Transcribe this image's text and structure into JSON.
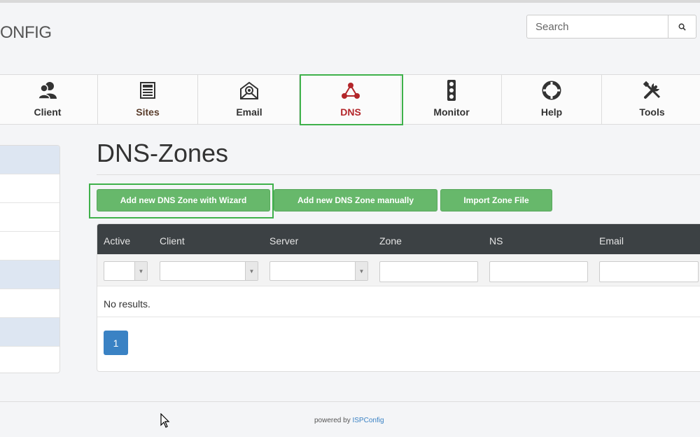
{
  "header": {
    "logo_text": "ONFIG",
    "search_placeholder": "Search",
    "search_icon": "magnifier-icon"
  },
  "nav": {
    "items": [
      {
        "label": "Client",
        "icon": "client-icon"
      },
      {
        "label": "Sites",
        "icon": "sites-icon"
      },
      {
        "label": "Email",
        "icon": "email-icon"
      },
      {
        "label": "DNS",
        "icon": "dns-icon"
      },
      {
        "label": "Monitor",
        "icon": "monitor-icon"
      },
      {
        "label": "Help",
        "icon": "help-icon"
      },
      {
        "label": "Tools",
        "icon": "tools-icon"
      }
    ],
    "active": "DNS",
    "active_color": "#b3262a",
    "highlight_color": "#3fb14b"
  },
  "main": {
    "title": "DNS-Zones",
    "buttons": {
      "wizard": "Add new DNS Zone with Wizard",
      "manual": "Add new DNS Zone manually",
      "import": "Import Zone File"
    },
    "button_color": "#67b86b",
    "table": {
      "columns": [
        "Active",
        "Client",
        "Server",
        "Zone",
        "NS",
        "Email"
      ],
      "empty_text": "No results."
    },
    "pagination": {
      "current": "1"
    }
  },
  "footer": {
    "prefix": "powered by",
    "brand": "ISPConfig"
  }
}
